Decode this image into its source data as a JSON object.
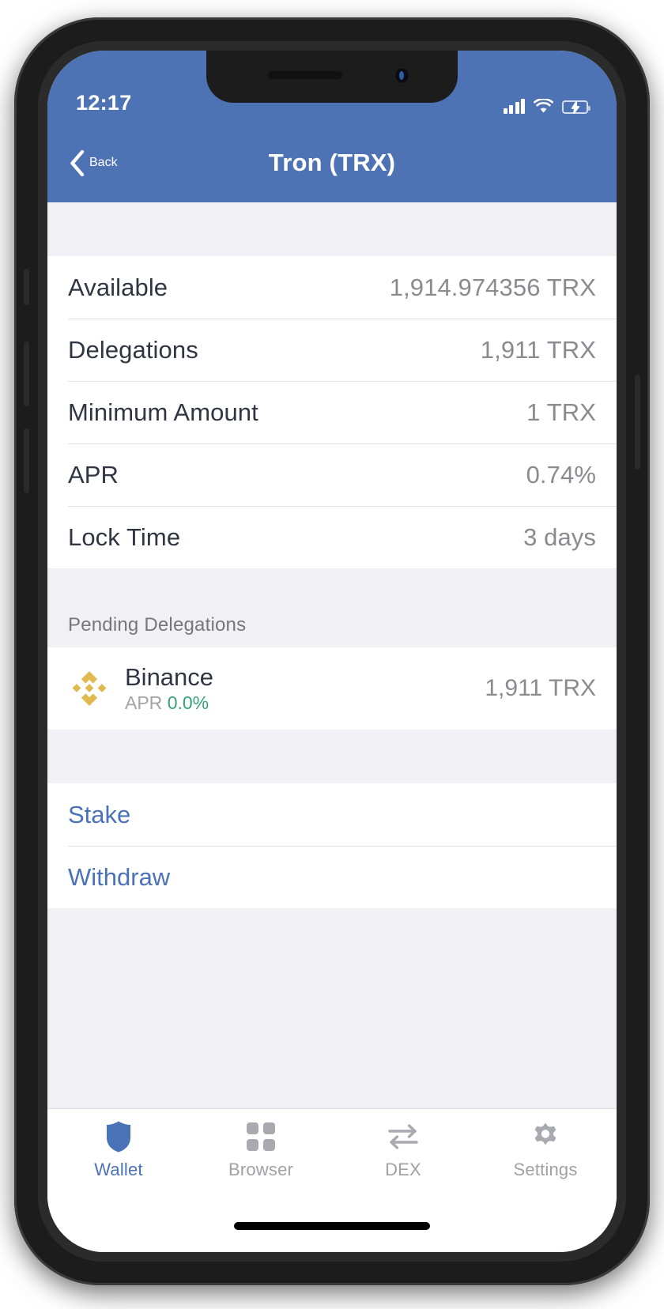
{
  "status_bar": {
    "time": "12:17",
    "signal_icon": "cellular-signal-icon",
    "wifi_icon": "wifi-icon",
    "battery_icon": "battery-charging-icon"
  },
  "nav": {
    "back_label": "Back",
    "back_icon": "chevron-left-icon",
    "title": "Tron (TRX)"
  },
  "info_rows": [
    {
      "label": "Available",
      "value": "1,914.974356 TRX"
    },
    {
      "label": "Delegations",
      "value": "1,911 TRX"
    },
    {
      "label": "Minimum Amount",
      "value": "1 TRX"
    },
    {
      "label": "APR",
      "value": "0.74%"
    },
    {
      "label": "Lock Time",
      "value": "3 days"
    }
  ],
  "pending_section": {
    "header": "Pending Delegations",
    "validator": {
      "logo_icon": "binance-logo-icon",
      "name": "Binance",
      "apr_label": "APR",
      "apr_value": "0.0%",
      "amount": "1,911 TRX"
    }
  },
  "actions": [
    {
      "label": "Stake"
    },
    {
      "label": "Withdraw"
    }
  ],
  "tab_bar": {
    "items": [
      {
        "label": "Wallet",
        "icon": "shield-icon",
        "active": true
      },
      {
        "label": "Browser",
        "icon": "grid-icon",
        "active": false
      },
      {
        "label": "DEX",
        "icon": "swap-arrows-icon",
        "active": false
      },
      {
        "label": "Settings",
        "icon": "gear-icon",
        "active": false
      }
    ]
  },
  "colors": {
    "header_blue": "#4e73b4",
    "link_blue": "#4a72b8",
    "binance_gold": "#e0b94f",
    "apr_green": "#35a07e",
    "page_background": "#f1f1f5",
    "battery_green": "#4ad65f"
  }
}
